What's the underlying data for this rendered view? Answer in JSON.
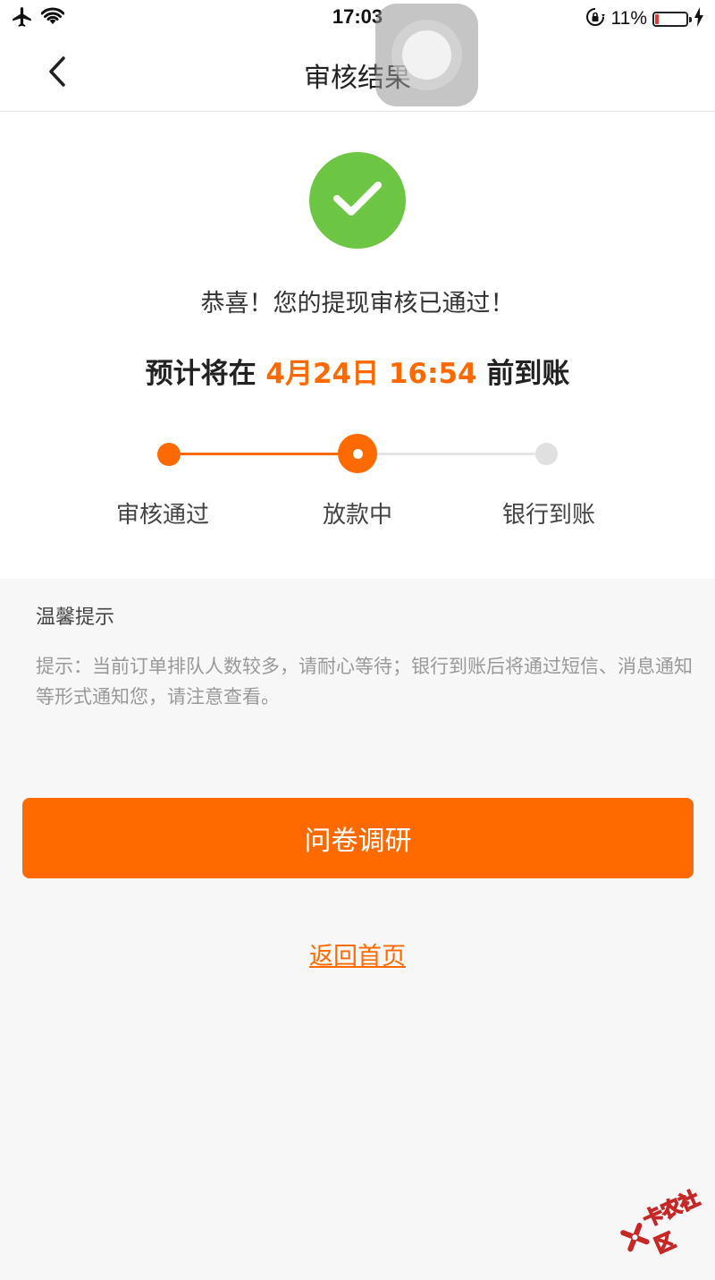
{
  "status_bar": {
    "time": "17:03",
    "battery_percent_text": "11%",
    "battery_level": 0.11,
    "icons": [
      "airplane-icon",
      "wifi-icon",
      "rotation-lock-icon",
      "charging-icon"
    ]
  },
  "nav": {
    "title": "审核结果",
    "back_icon": "chevron-left-icon"
  },
  "result": {
    "icon": "check-icon",
    "message": "恭喜！您的提现审核已通过！",
    "eta_prefix": "预计将在 ",
    "eta_time": "4月24日 16:54",
    "eta_suffix": " 前到账"
  },
  "progress": {
    "steps": [
      {
        "label": "审核通过",
        "state": "done"
      },
      {
        "label": "放款中",
        "state": "current"
      },
      {
        "label": "银行到账",
        "state": "todo"
      }
    ]
  },
  "tips": {
    "title": "温馨提示",
    "text": "提示：当前订单排队人数较多，请耐心等待；银行到账后将通过短信、消息通知等形式通知您，请注意查看。"
  },
  "actions": {
    "survey_label": "问卷调研",
    "home_label": "返回首页"
  },
  "watermark": {
    "text": "卡农社区"
  },
  "colors": {
    "accent": "#ff6a00",
    "success": "#6cc644",
    "inactive": "#e0e0e0"
  }
}
